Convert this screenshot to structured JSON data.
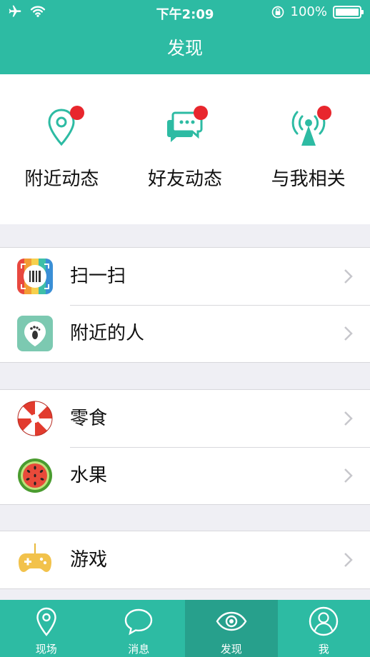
{
  "status_bar": {
    "time": "下午2:09",
    "battery_percent": "100%",
    "airplane_icon": "airplane-icon",
    "wifi_icon": "wifi-icon",
    "rotation_lock_icon": "rotation-lock-icon",
    "battery_icon": "battery-icon"
  },
  "nav": {
    "title": "发现"
  },
  "quick_actions": [
    {
      "label": "附近动态",
      "icon": "location-pin-icon",
      "badge": true
    },
    {
      "label": "好友动态",
      "icon": "chat-bubbles-icon",
      "badge": true
    },
    {
      "label": "与我相关",
      "icon": "broadcast-icon",
      "badge": true
    }
  ],
  "groups": [
    {
      "rows": [
        {
          "label": "扫一扫",
          "icon": "barcode-scanner-icon"
        },
        {
          "label": "附近的人",
          "icon": "footprint-icon"
        }
      ]
    },
    {
      "rows": [
        {
          "label": "零食",
          "icon": "candy-icon"
        },
        {
          "label": "水果",
          "icon": "watermelon-icon"
        }
      ]
    },
    {
      "rows": [
        {
          "label": "游戏",
          "icon": "gamepad-icon"
        }
      ]
    }
  ],
  "tabbar": {
    "items": [
      {
        "label": "现场",
        "icon": "location-pin-icon",
        "active": false
      },
      {
        "label": "消息",
        "icon": "speech-bubble-icon",
        "active": false
      },
      {
        "label": "发现",
        "icon": "eye-icon",
        "active": true
      },
      {
        "label": "我",
        "icon": "user-icon",
        "active": false
      }
    ]
  },
  "colors": {
    "accent": "#2dbba3",
    "accent_dark": "#27a08c",
    "badge": "#e8262d",
    "background": "#efeff4"
  }
}
